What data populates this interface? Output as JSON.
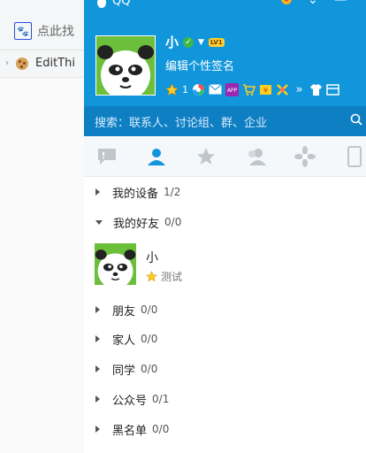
{
  "browser": {
    "tab_label": "点此找",
    "bookmark_label": "EditThi"
  },
  "qq": {
    "window_title": "QQ",
    "profile": {
      "nickname": "小",
      "level": "LV1",
      "signature": "编辑个性签名",
      "star_count": "1"
    },
    "search_placeholder": "搜索：联系人、讨论组、群、企业",
    "tabs": [
      {
        "name": "messages",
        "icon": "chat-icon"
      },
      {
        "name": "contacts",
        "icon": "person-icon",
        "active": true
      },
      {
        "name": "favorites",
        "icon": "star-icon"
      },
      {
        "name": "groups",
        "icon": "group-icon"
      },
      {
        "name": "apps",
        "icon": "flower-icon"
      },
      {
        "name": "devices",
        "icon": "phone-icon"
      }
    ],
    "groups": [
      {
        "label": "我的设备",
        "count": "1/2",
        "expanded": false
      },
      {
        "label": "我的好友",
        "count": "0/0",
        "expanded": true
      },
      {
        "label": "朋友",
        "count": "0/0",
        "expanded": false
      },
      {
        "label": "家人",
        "count": "0/0",
        "expanded": false
      },
      {
        "label": "同学",
        "count": "0/0",
        "expanded": false
      },
      {
        "label": "公众号",
        "count": "0/1",
        "expanded": false
      },
      {
        "label": "黑名单",
        "count": "0/0",
        "expanded": false
      }
    ],
    "friend": {
      "name": "小",
      "status": "测试"
    },
    "colors": {
      "header_blue": "#1296db",
      "search_blue": "#0e7fc3",
      "active_tab": "#1296db"
    }
  }
}
